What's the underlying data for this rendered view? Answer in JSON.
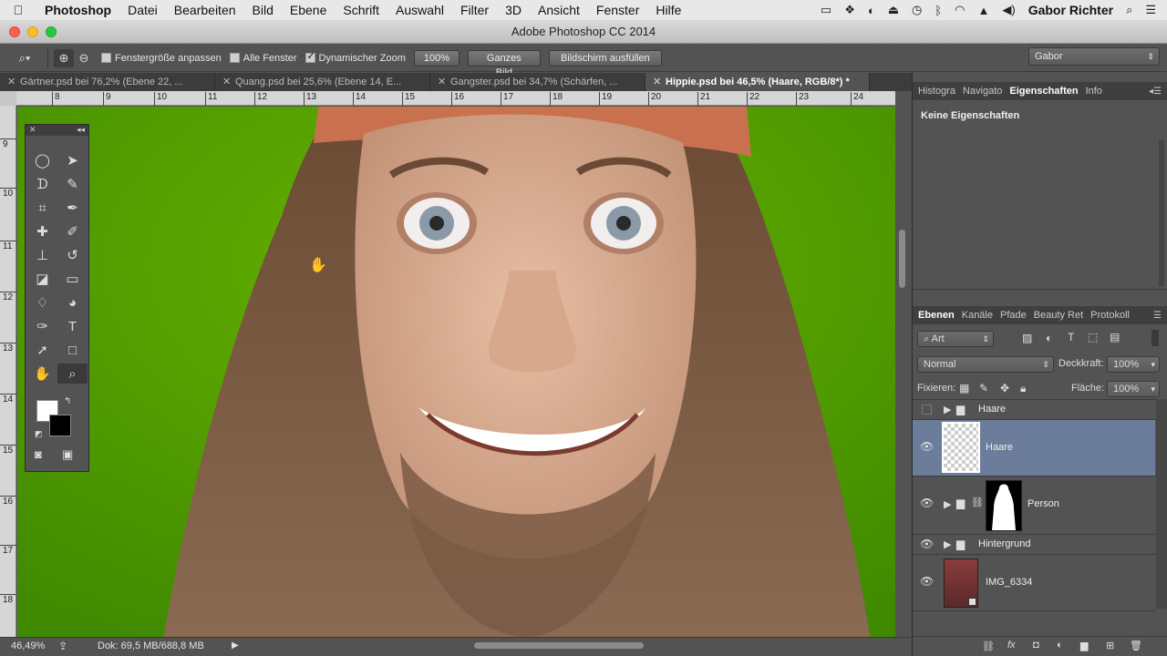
{
  "menubar": {
    "app_name": "Photoshop",
    "items": [
      "Datei",
      "Bearbeiten",
      "Bild",
      "Ebene",
      "Schrift",
      "Auswahl",
      "Filter",
      "3D",
      "Ansicht",
      "Fenster",
      "Hilfe"
    ],
    "user": "Gabor Richter"
  },
  "window": {
    "title": "Adobe Photoshop CC 2014"
  },
  "options_bar": {
    "resize_window_label": "Fenstergröße anpassen",
    "resize_window_checked": false,
    "all_windows_label": "Alle Fenster",
    "all_windows_checked": false,
    "dynamic_zoom_label": "Dynamischer Zoom",
    "dynamic_zoom_checked": true,
    "zoom_100_label": "100%",
    "fit_screen_label": "Ganzes Bild",
    "fill_screen_label": "Bildschirm ausfüllen",
    "workspace": "Gabor"
  },
  "document_tabs": [
    {
      "label": "Gärtner.psd bei 76,2% (Ebene 22, ...",
      "active": false
    },
    {
      "label": "Quang.psd bei 25,6% (Ebene 14, E...",
      "active": false
    },
    {
      "label": "Gangster.psd bei 34,7% (Schärfen, ...",
      "active": false
    },
    {
      "label": "Hippie.psd bei 46,5% (Haare, RGB/8*) *",
      "active": true
    }
  ],
  "rulers": {
    "horizontal": [
      "8",
      "9",
      "10",
      "11",
      "12",
      "13",
      "14",
      "15",
      "16",
      "17",
      "18",
      "19",
      "20",
      "21",
      "22",
      "23",
      "24"
    ],
    "vertical": [
      "9",
      "10",
      "11",
      "12",
      "13",
      "14",
      "15",
      "16",
      "17",
      "18"
    ]
  },
  "status_bar": {
    "zoom": "46,49%",
    "doc_info": "Dok: 69,5 MB/688,8 MB"
  },
  "properties_panel": {
    "tabs": [
      "Histogra",
      "Navigato",
      "Eigenschaften",
      "Info"
    ],
    "active_tab": "Eigenschaften",
    "content": "Keine Eigenschaften"
  },
  "layers_panel": {
    "tabs": [
      "Ebenen",
      "Kanäle",
      "Pfade",
      "Beauty Ret",
      "Protokoll"
    ],
    "active_tab": "Ebenen",
    "filter_kind": "Art",
    "blend_mode": "Normal",
    "opacity_label": "Deckkraft:",
    "opacity_value": "100%",
    "lock_label": "Fixieren:",
    "fill_label": "Fläche:",
    "fill_value": "100%",
    "layers": [
      {
        "name": "Haare",
        "type": "group",
        "visible": false,
        "selected": false
      },
      {
        "name": "Haare",
        "type": "layer",
        "visible": true,
        "selected": true
      },
      {
        "name": "Person",
        "type": "group-masked",
        "visible": true,
        "selected": false
      },
      {
        "name": "Hintergrund",
        "type": "group",
        "visible": true,
        "selected": false
      },
      {
        "name": "IMG_6334",
        "type": "smart-object",
        "visible": true,
        "selected": false
      }
    ]
  },
  "colors": {
    "canvas_green": "#5aa300",
    "selected_layer": "#6b7d9b",
    "foreground": "#ffffff",
    "background": "#000000"
  }
}
